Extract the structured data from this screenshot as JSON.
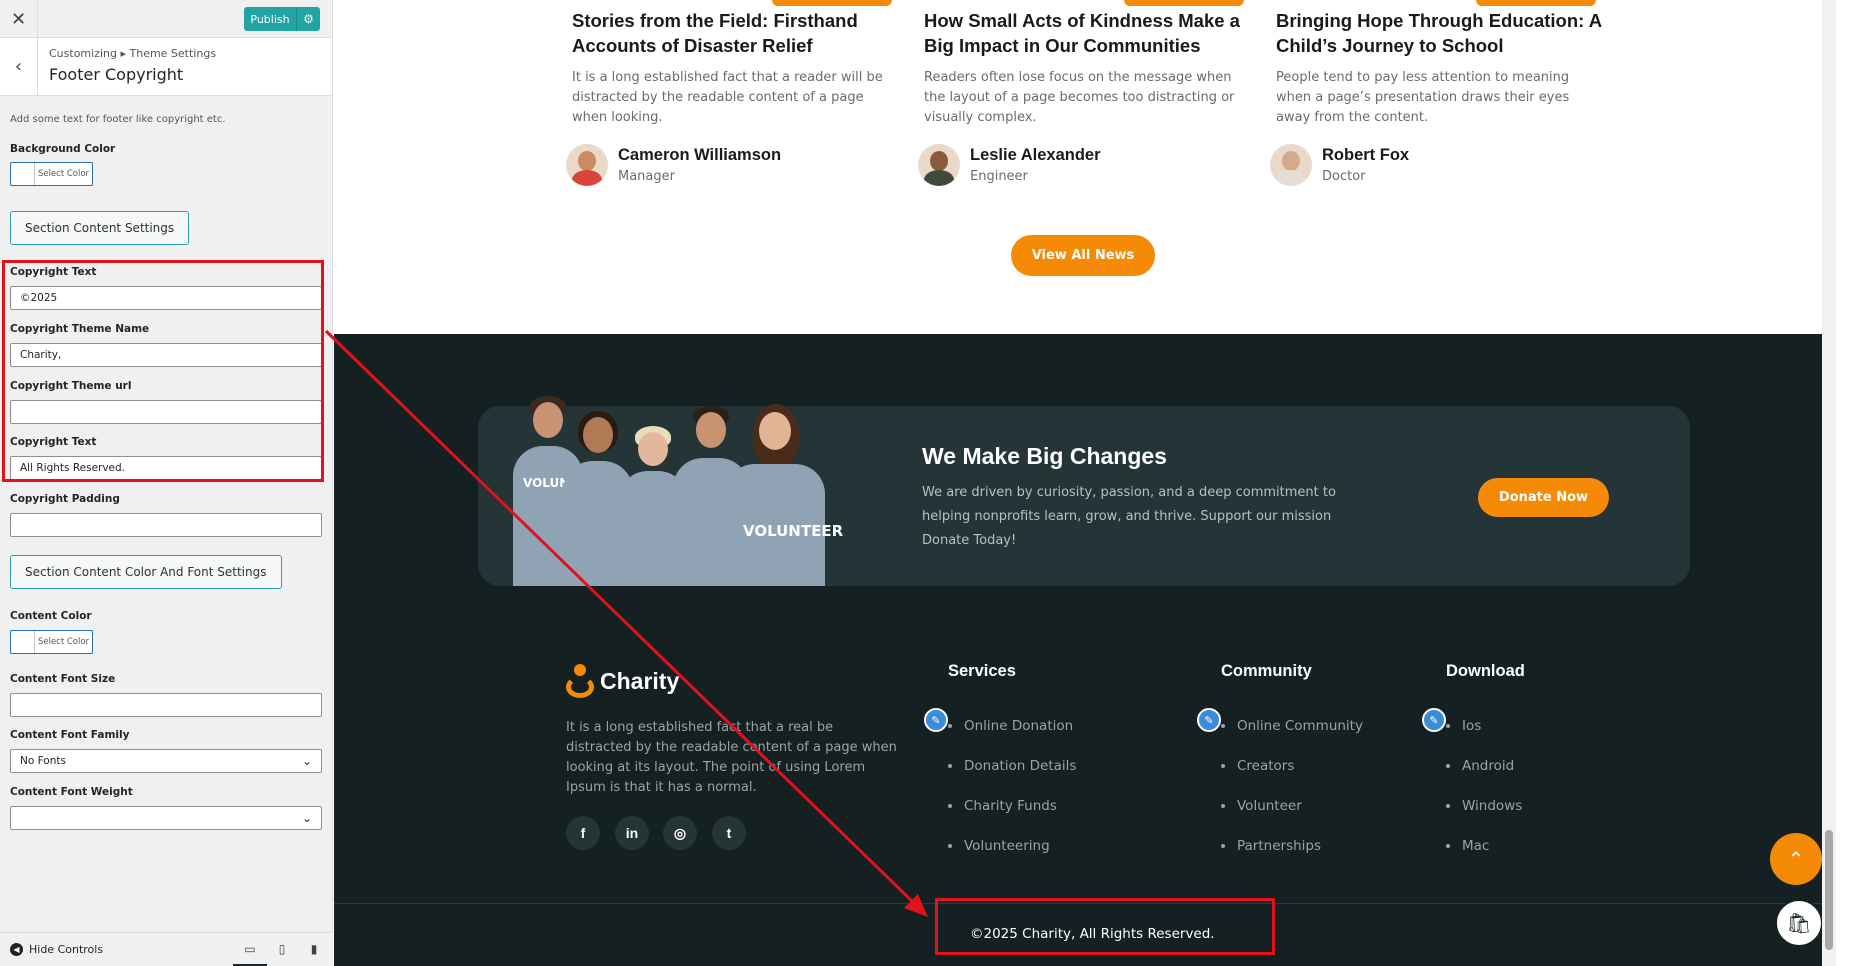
{
  "customizer": {
    "close": "✕",
    "publish": "Publish",
    "publish_settings_icon": "gear-icon",
    "back": "‹",
    "breadcrumb": "Customizing ▸ Theme Settings",
    "title": "Footer Copyright",
    "description": "Add some text for footer like copyright etc.",
    "background_color_label": "Background Color",
    "select_color": "Select Color",
    "section_content_settings": "Section Content Settings",
    "copyright_text_label": "Copyright Text",
    "copyright_text_value": "©2025",
    "theme_name_label": "Copyright Theme Name",
    "theme_name_value": "Charity,",
    "theme_url_label": "Copyright Theme url",
    "theme_url_value": "",
    "copyright_text2_label": "Copyright Text",
    "copyright_text2_value": "All Rights Reserved.",
    "padding_label": "Copyright Padding",
    "padding_value": "",
    "color_font_settings": "Section Content Color And Font Settings",
    "content_color_label": "Content Color",
    "content_font_size_label": "Content Font Size",
    "content_font_size_value": "",
    "content_font_family_label": "Content Font Family",
    "content_font_family_value": "No Fonts",
    "content_font_weight_label": "Content Font Weight",
    "content_font_weight_value": "",
    "hide_controls": "Hide Controls",
    "accent_color": "#22a4a4",
    "highlight_color": "#e0121a"
  },
  "news": [
    {
      "title": "Stories from the Field: Firsthand Accounts of Disaster Relief",
      "excerpt": "It is a long established fact that a reader will be distracted by the readable content of a page when looking.",
      "author": "Cameron Williamson",
      "role": "Manager"
    },
    {
      "title": "How Small Acts of Kindness Make a Big Impact in Our Communities",
      "excerpt": "Readers often lose focus on the message when the layout of a page becomes too distracting or visually complex.",
      "author": "Leslie Alexander",
      "role": "Engineer"
    },
    {
      "title": "Bringing Hope Through Education: A Child’s Journey to School",
      "excerpt": "People tend to pay less attention to meaning when a page’s presentation draws their eyes away from the content.",
      "author": "Robert Fox",
      "role": "Doctor"
    }
  ],
  "view_all": "View All News",
  "cta": {
    "title": "We Make Big Changes",
    "text": "We are driven by curiosity, passion, and a deep commitment to helping nonprofits learn, grow, and thrive. Support our mission Donate Today!",
    "donate": "Donate Now",
    "shirt_print": "VOLUNTEER"
  },
  "footer": {
    "logo": "Charity",
    "about": "It is a long established fact that a real be distracted by the readable content of a page when looking at its layout. The point of using Lorem Ipsum is that it has a normal.",
    "social": [
      "f",
      "in",
      "◎",
      "t"
    ],
    "columns": [
      {
        "title": "Services",
        "items": [
          "Online Donation",
          "Donation Details",
          "Charity Funds",
          "Volunteering"
        ]
      },
      {
        "title": "Community",
        "items": [
          "Online Community",
          "Creators",
          "Volunteer",
          "Partnerships"
        ]
      },
      {
        "title": "Download",
        "items": [
          "Ios",
          "Android",
          "Windows",
          "Mac"
        ]
      }
    ],
    "copyright": "©2025 Charity, All Rights Reserved.",
    "brand_color": "#f58a07",
    "bg_color": "#152022"
  }
}
